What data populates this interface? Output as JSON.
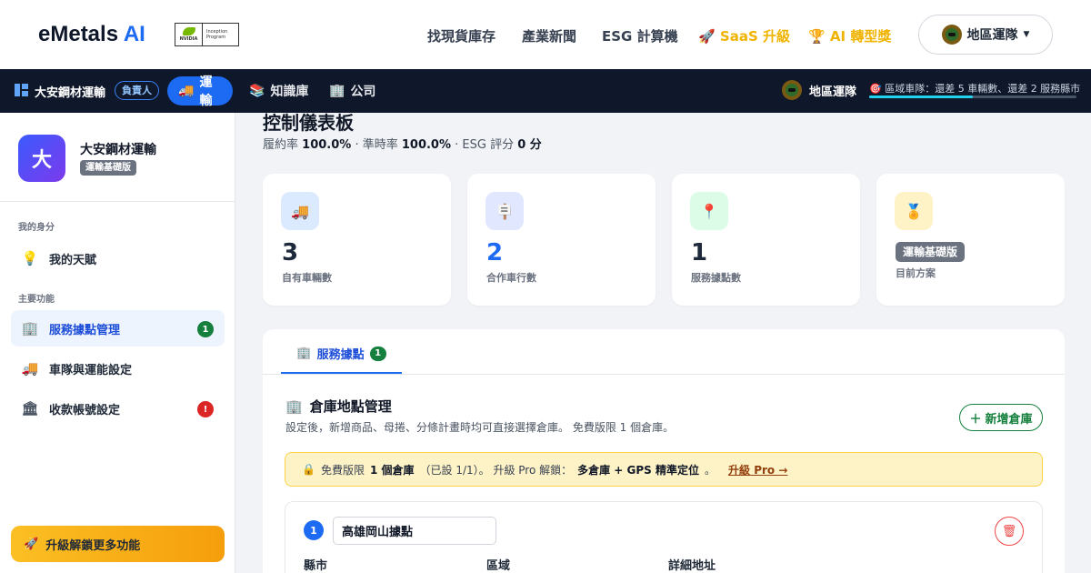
{
  "header": {
    "brand_main": "eMetals",
    "brand_ai": "AI",
    "nvidia_badge": {
      "logo": "NVIDIA",
      "line1": "Inception",
      "line2": "Program"
    },
    "nav": [
      {
        "label": "找現貨庫存"
      },
      {
        "label": "產業新聞"
      },
      {
        "label": "ESG 計算機"
      },
      {
        "label": "SaaS 升級",
        "icon": "rocket-icon"
      },
      {
        "label": "AI 轉型獎",
        "icon": "trophy-icon"
      }
    ],
    "region_button": "地區運隊"
  },
  "subbar": {
    "company": "大安鋼材運輸",
    "role": "負責人",
    "tabs": [
      {
        "label": "運輸",
        "icon": "truck-icon",
        "active": true
      },
      {
        "label": "知識庫",
        "icon": "books-icon"
      },
      {
        "label": "公司",
        "icon": "building-icon"
      }
    ],
    "region_label": "地區運隊",
    "region_status": "區域車隊：還差 5 車輛數、還差 2 服務縣市",
    "region_progress": 0.5
  },
  "sidebar": {
    "avatar_letter": "大",
    "company": "大安鋼材運輸",
    "plan": "運輸基礎版",
    "section_identity": "我的身分",
    "identity_items": [
      {
        "label": "我的天賦",
        "icon": "lightbulb-icon"
      }
    ],
    "section_main": "主要功能",
    "main_items": [
      {
        "label": "服務據點管理",
        "icon": "building-check-icon",
        "badge": "1",
        "active": true
      },
      {
        "label": "車隊與運能設定",
        "icon": "truck-icon"
      },
      {
        "label": "收款帳號設定",
        "icon": "bank-icon",
        "badge": "!"
      }
    ],
    "upgrade_button": "升級解鎖更多功能"
  },
  "main": {
    "title": "控制儀表板",
    "sub_fulfill_label": "履約率",
    "sub_fulfill_value": "100.0%",
    "sub_ontime_label": "· 準時率",
    "sub_ontime_value": "100.0%",
    "sub_esg_label": "· ESG 評分",
    "sub_esg_value": "0 分",
    "stats": [
      {
        "value": "3",
        "label": "自有車輛數",
        "icon": "truck-icon",
        "color": "#1e293b",
        "icon_bg": "#dbeafe"
      },
      {
        "value": "2",
        "label": "合作車行數",
        "icon": "signpost-icon",
        "color": "#1d6bf3",
        "icon_bg": "#e0e7ff"
      },
      {
        "value": "1",
        "label": "服務據點數",
        "icon": "location-pin-icon",
        "color": "#1e293b",
        "icon_bg": "#dcfce7"
      },
      {
        "value": "運輸基礎版",
        "label": "目前方案",
        "icon": "award-icon",
        "icon_bg": "#fef3c7"
      }
    ],
    "tab_label": "服務據點",
    "tab_count": "1",
    "warehouse_title": "倉庫地點管理",
    "warehouse_desc": "設定後，新增商品、母捲、分條計畫時均可直接選擇倉庫。 免費版限 1 個倉庫。",
    "add_button": "新增倉庫",
    "notice_prefix": "免費版限",
    "notice_bold1": "1 個倉庫",
    "notice_mid": "（已設 1/1）。 升級 Pro 解鎖：",
    "notice_bold2": "多倉庫 + GPS 精準定位",
    "notice_suffix": "。",
    "notice_link": "升級 Pro →",
    "site": {
      "number": "1",
      "name_value": "高雄岡山據點",
      "col_county": "縣市",
      "col_district": "區域",
      "col_address": "詳細地址"
    }
  }
}
